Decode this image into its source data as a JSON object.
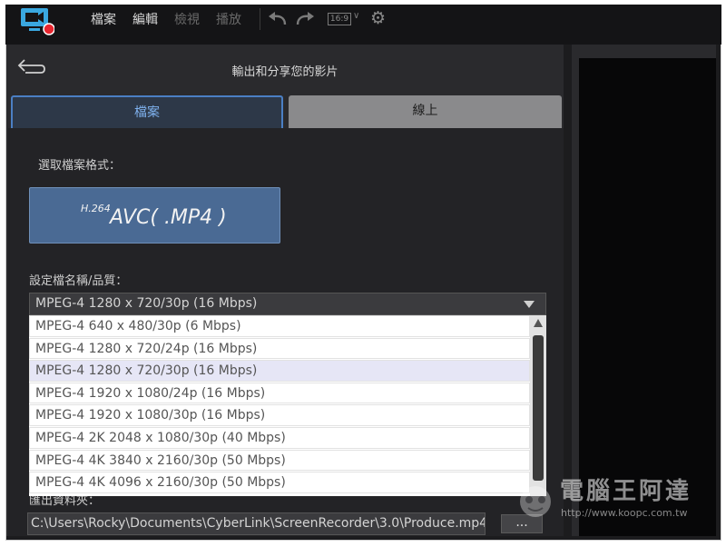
{
  "menu": {
    "file": "檔案",
    "edit": "編輯",
    "view": "檢視",
    "play": "播放",
    "aspect": "16:9"
  },
  "panel": {
    "title": "輸出和分享您的影片",
    "tabs": [
      "檔案",
      "線上"
    ]
  },
  "format": {
    "label": "選取檔案格式：",
    "button_sup": "H.264",
    "button_main": "AVC( .MP4 )"
  },
  "quality": {
    "label": "設定檔名稱/品質：",
    "selected": "MPEG-4 1280 x 720/30p (16 Mbps)",
    "options": [
      "MPEG-4 640 x 480/30p (6 Mbps)",
      "MPEG-4 1280 x 720/24p (16 Mbps)",
      "MPEG-4 1280 x 720/30p (16 Mbps)",
      "MPEG-4 1920 x 1080/24p (16 Mbps)",
      "MPEG-4 1920 x 1080/30p (16 Mbps)",
      "MPEG-4 2K 2048 x 1080/30p (40 Mbps)",
      "MPEG-4 4K 3840 x 2160/30p (50 Mbps)",
      "MPEG-4 4K 4096 x 2160/30p (50 Mbps)"
    ]
  },
  "output": {
    "label": "匯出資料夾：",
    "path": "C:\\Users\\Rocky\\Documents\\CyberLink\\ScreenRecorder\\3.0\\Produce.mp4",
    "browse": "..."
  },
  "watermark": {
    "text": "電腦王阿達",
    "url": "http://www.koopc.com.tw"
  },
  "colors": {
    "accent": "#4b7fc4",
    "format_button": "#4a6a94",
    "logo_blue": "#3aa8e0",
    "logo_red": "#e8262f"
  }
}
